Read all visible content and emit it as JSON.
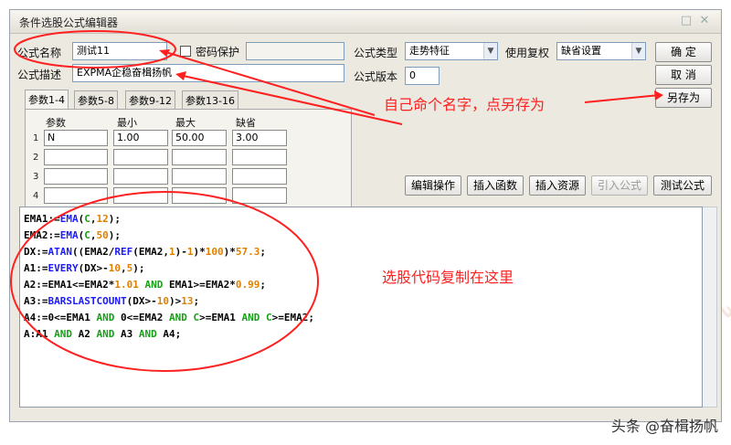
{
  "window": {
    "title": "条件选股公式编辑器",
    "minimize_glyph": "□",
    "close_glyph": "✕"
  },
  "form": {
    "name_label": "公式名称",
    "name_value": "测试11",
    "password_label": "密码保护",
    "desc_label": "公式描述",
    "desc_value": "EXPMA企稳奋楫扬帆",
    "type_label": "公式类型",
    "type_value": "走势特征",
    "rights_label": "使用复权",
    "rights_value": "缺省设置",
    "version_label": "公式版本",
    "version_value": "0"
  },
  "buttons": {
    "ok": "确  定",
    "cancel": "取  消",
    "save_as": "另存为",
    "edit_ops": "编辑操作",
    "insert_func": "插入函数",
    "insert_res": "插入资源",
    "import_formula": "引入公式",
    "test_formula": "测试公式"
  },
  "tabs": [
    "参数1-4",
    "参数5-8",
    "参数9-12",
    "参数13-16"
  ],
  "params": {
    "headers": [
      "参数",
      "最小",
      "最大",
      "缺省"
    ],
    "rows": [
      {
        "num": "1",
        "name": "N",
        "min": "1.00",
        "max": "50.00",
        "def": "3.00"
      },
      {
        "num": "2",
        "name": "",
        "min": "",
        "max": "",
        "def": ""
      },
      {
        "num": "3",
        "name": "",
        "min": "",
        "max": "",
        "def": ""
      },
      {
        "num": "4",
        "name": "",
        "min": "",
        "max": "",
        "def": ""
      }
    ]
  },
  "code": [
    "EMA1:=EMA(C,12);",
    "EMA2:=EMA(C,50);",
    "DX:=ATAN((EMA2/REF(EMA2,1)-1)*100)*57.3;",
    "A1:=EVERY(DX>-10,5);",
    "A2:=EMA1<=EMA2*1.01 AND EMA1>=EMA2*0.99;",
    "A3:=BARSLASTCOUNT(DX>-10)>13;",
    "A4:=0<=EMA1 AND 0<=EMA2 AND C>=EMA1 AND C>=EMA2;",
    "A:A1 AND A2 AND A3 AND A4;"
  ],
  "annotations": {
    "name_hint": "自己命个名字，点另存为",
    "code_hint": "选股代码复制在这里"
  },
  "watermark": {
    "text": "奋楫扬帆",
    "footer": "头条 @奋楫扬帆"
  },
  "colors": {
    "annotation_red": "#ff2020",
    "keyword_green": "#16a016",
    "function_blue": "#1a1aff",
    "number_orange": "#e08000"
  }
}
